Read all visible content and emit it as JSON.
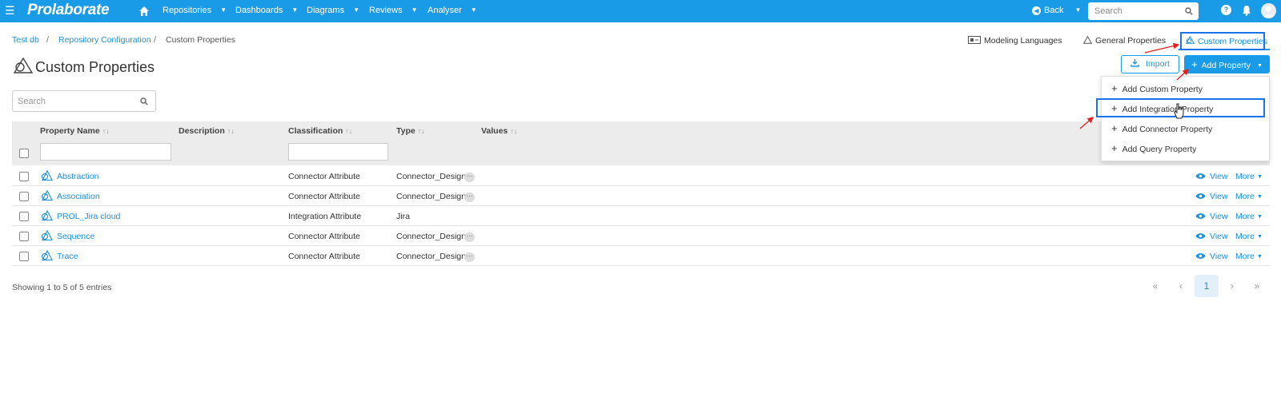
{
  "topbar": {
    "logo": "Prolaborate",
    "nav": [
      "Repositories",
      "Dashboards",
      "Diagrams",
      "Reviews",
      "Analyser"
    ],
    "back_label": "Back",
    "search_placeholder": "Search",
    "help_glyph": "?"
  },
  "breadcrumb": [
    "Test db",
    "Repository Configuration",
    "Custom Properties"
  ],
  "tabs": [
    "Modeling Languages",
    "General Properties",
    "Custom Properties"
  ],
  "page": {
    "title": "Custom Properties",
    "import_label": "Import",
    "add_property_label": "Add Property",
    "search_placeholder": "Search"
  },
  "add_menu": [
    "Add Custom Property",
    "Add Integration Property",
    "Add Connector Property",
    "Add Query Property"
  ],
  "table": {
    "columns": [
      "Property Name",
      "Description",
      "Classification",
      "Type",
      "Values"
    ],
    "rows": [
      {
        "name": "Abstraction",
        "description": "",
        "classification": "Connector Attribute",
        "type": "Connector_Design",
        "has_more": true
      },
      {
        "name": "Association",
        "description": "",
        "classification": "Connector Attribute",
        "type": "Connector_Design",
        "has_more": true
      },
      {
        "name": "PROL_Jira cloud",
        "description": "",
        "classification": "Integration Attribute",
        "type": "Jira",
        "has_more": false
      },
      {
        "name": "Sequence",
        "description": "",
        "classification": "Connector Attribute",
        "type": "Connector_Design",
        "has_more": true
      },
      {
        "name": "Trace",
        "description": "",
        "classification": "Connector Attribute",
        "type": "Connector_Design",
        "has_more": true
      }
    ],
    "row_actions": {
      "view": "View",
      "more": "More"
    }
  },
  "footer": {
    "entries_text": "Showing 1 to 5 of 5 entries",
    "current_page": "1"
  },
  "colors": {
    "brand": "#1a9be8",
    "link": "#1a8fd8",
    "highlight": "#1a73e8",
    "arrow": "#e02020"
  }
}
